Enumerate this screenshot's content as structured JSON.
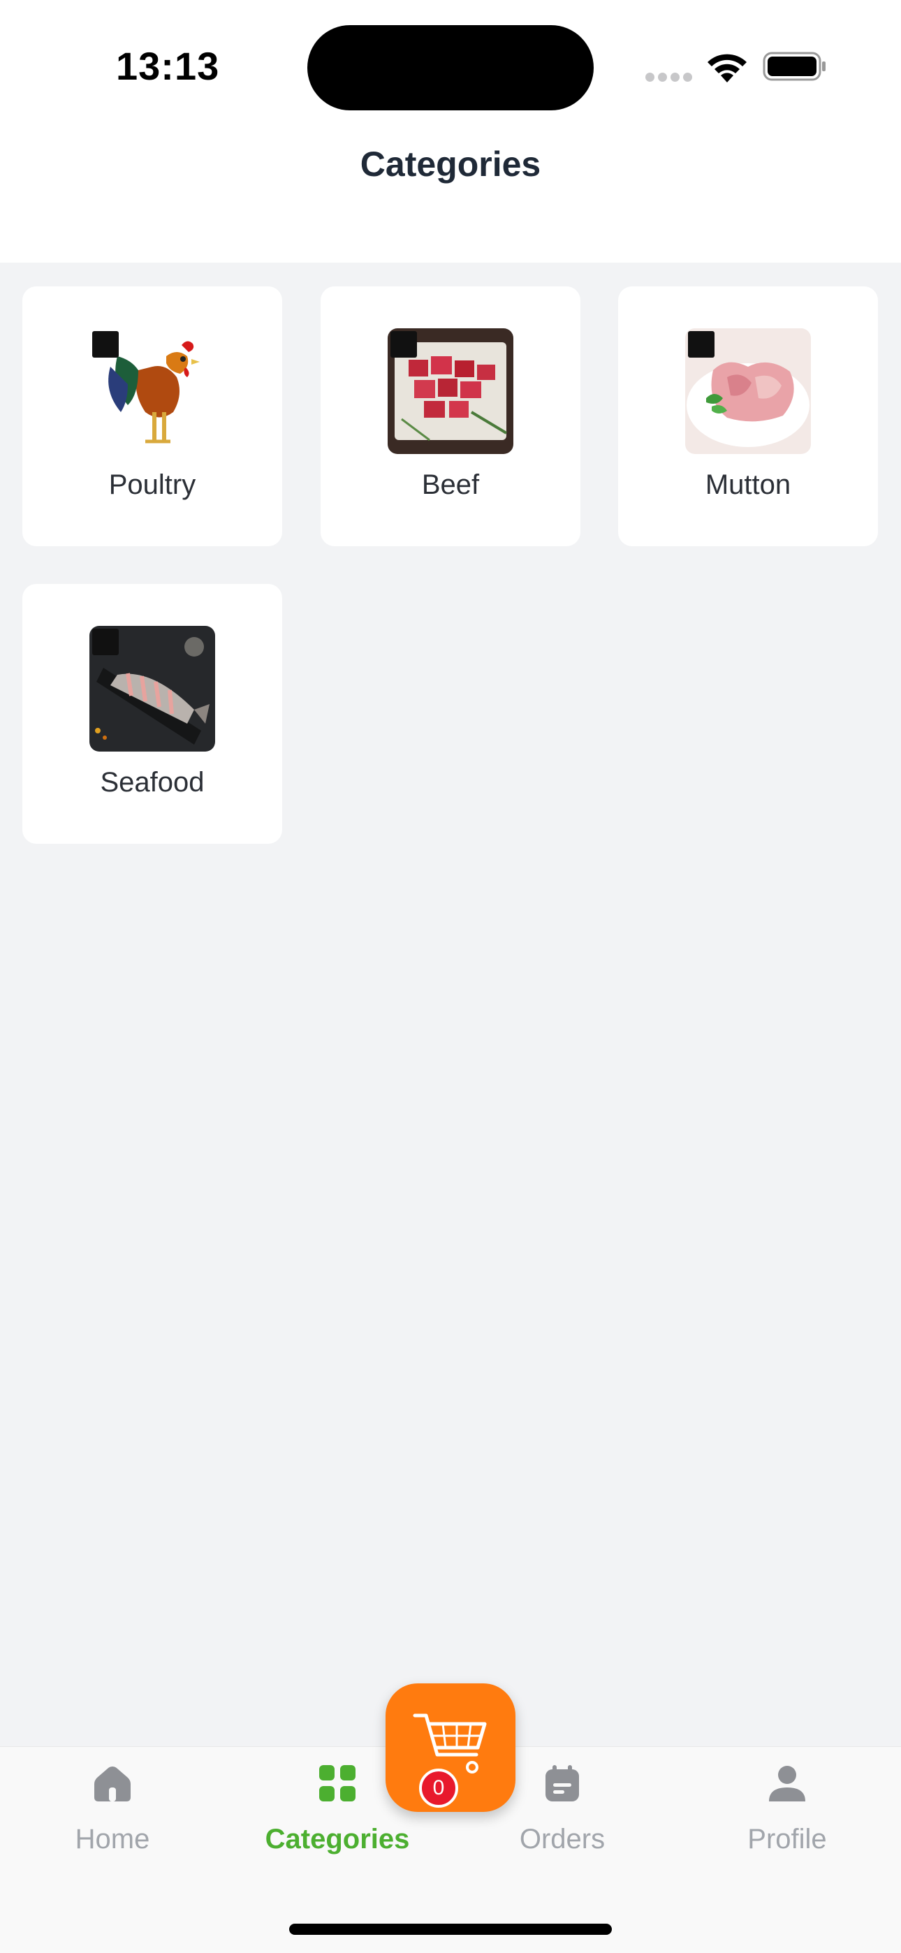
{
  "status_bar": {
    "time": "13:13"
  },
  "header": {
    "title": "Categories"
  },
  "categories": [
    {
      "label": "Poultry",
      "icon": "rooster-image"
    },
    {
      "label": "Beef",
      "icon": "beef-cubes-image"
    },
    {
      "label": "Mutton",
      "icon": "mutton-image"
    },
    {
      "label": "Seafood",
      "icon": "fish-image"
    }
  ],
  "tab_bar": {
    "items": [
      {
        "label": "Home",
        "icon": "home-icon"
      },
      {
        "label": "Categories",
        "icon": "grid-icon",
        "active": true
      },
      {
        "label": "Orders",
        "icon": "calendar-icon"
      },
      {
        "label": "Profile",
        "icon": "user-icon"
      }
    ]
  },
  "cart": {
    "count": "0"
  },
  "colors": {
    "accent_green": "#4caf30",
    "cart_orange": "#ff7b0f",
    "badge_red": "#e8192c",
    "background": "#f2f3f5"
  }
}
